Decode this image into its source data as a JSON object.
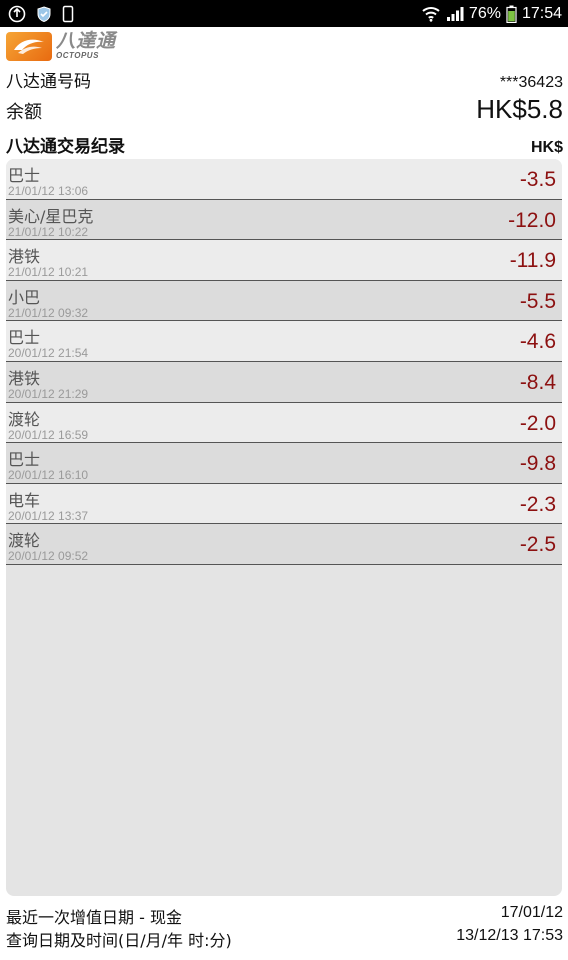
{
  "status_bar": {
    "battery": "76%",
    "time": "17:54",
    "icons": [
      "usb-debug-icon",
      "shield-icon",
      "phone-icon",
      "wifi-icon",
      "signal-icon",
      "battery-icon"
    ]
  },
  "logo": {
    "cn": "八達通",
    "en": "OCTOPUS"
  },
  "card": {
    "label": "八达通号码",
    "number": "***36423"
  },
  "balance": {
    "label": "余额",
    "value": "HK$5.8"
  },
  "transactions_header": {
    "label": "八达通交易纪录",
    "currency": "HK$"
  },
  "transactions": [
    {
      "name": "巴士",
      "time": "21/01/12 13:06",
      "amount": "-3.5"
    },
    {
      "name": "美心/星巴克",
      "time": "21/01/12 10:22",
      "amount": "-12.0"
    },
    {
      "name": "港铁",
      "time": "21/01/12 10:21",
      "amount": "-11.9"
    },
    {
      "name": "小巴",
      "time": "21/01/12 09:32",
      "amount": "-5.5"
    },
    {
      "name": "巴士",
      "time": "20/01/12 21:54",
      "amount": "-4.6"
    },
    {
      "name": "港铁",
      "time": "20/01/12 21:29",
      "amount": "-8.4"
    },
    {
      "name": "渡轮",
      "time": "20/01/12 16:59",
      "amount": "-2.0"
    },
    {
      "name": "巴士",
      "time": "20/01/12 16:10",
      "amount": "-9.8"
    },
    {
      "name": "电车",
      "time": "20/01/12 13:37",
      "amount": "-2.3"
    },
    {
      "name": "渡轮",
      "time": "20/01/12 09:52",
      "amount": "-2.5"
    }
  ],
  "footer": {
    "last_topup_label": "最近一次增值日期 - 现金",
    "last_topup_date": "17/01/12",
    "query_label": "查询日期及时间(日/月/年 时:分)",
    "query_time": "13/12/13 17:53"
  },
  "colors": {
    "amount": "#8c1010",
    "logo_orange": "#e86a10"
  }
}
